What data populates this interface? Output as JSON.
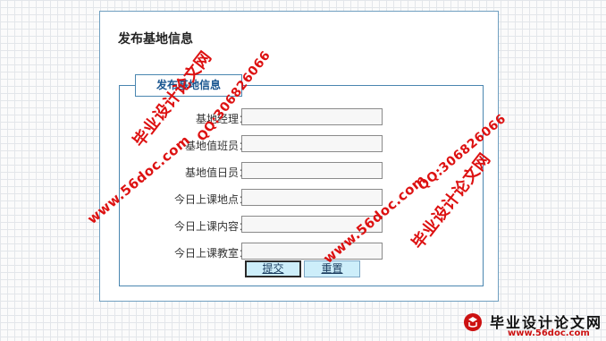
{
  "page": {
    "title": "发布基地信息"
  },
  "form": {
    "legend": "发布基地信息",
    "fields": [
      {
        "label": "基地经理：",
        "value": ""
      },
      {
        "label": "基地值班员：",
        "value": ""
      },
      {
        "label": "基地值日员：",
        "value": ""
      },
      {
        "label": "今日上课地点：",
        "value": ""
      },
      {
        "label": "今日上课内容：",
        "value": ""
      },
      {
        "label": "今日上课教室：",
        "value": ""
      }
    ],
    "submit_label": "提交",
    "reset_label": "重置"
  },
  "watermarks": {
    "site_name": "毕业设计论文网",
    "site_url": "www.56doc.com",
    "qq": "QQ:306826066",
    "site_color": "#dd1111"
  },
  "logo": {
    "title": "毕业设计论文网",
    "url": "www.56doc.com"
  }
}
